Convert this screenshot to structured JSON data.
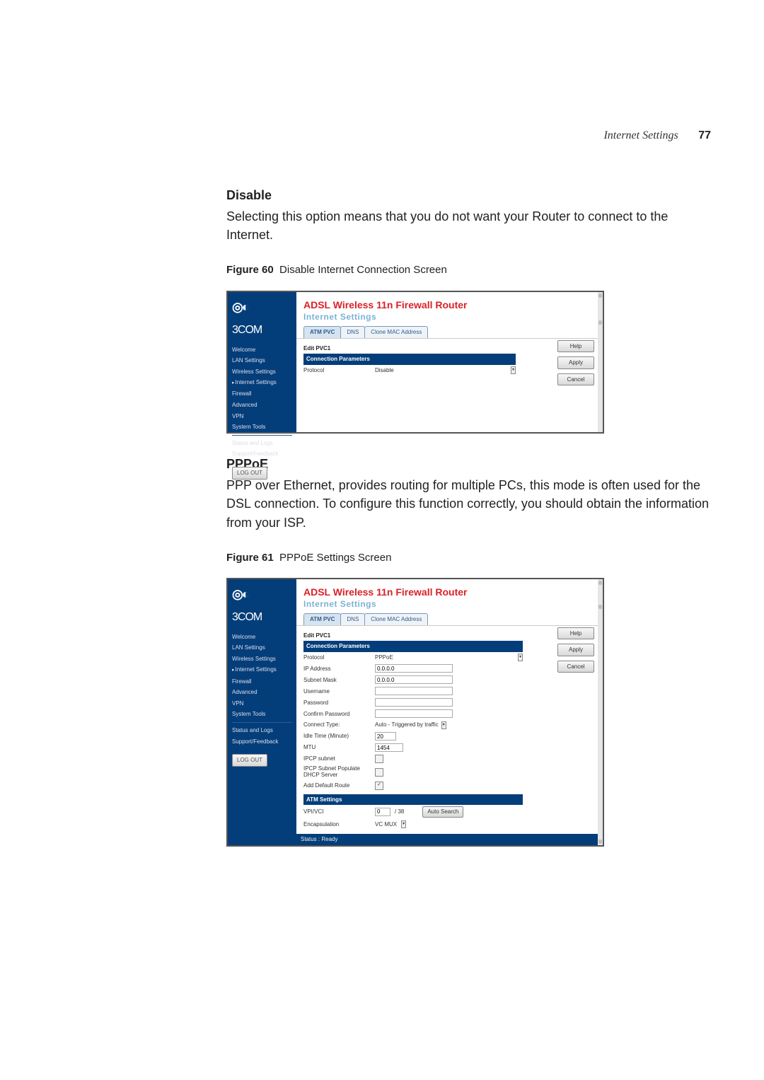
{
  "header": {
    "title": "Internet Settings",
    "page": "77"
  },
  "sections": {
    "disable": {
      "heading": "Disable",
      "text": "Selecting this option means that you do not want your Router to connect to the Internet."
    },
    "pppoe": {
      "heading": "PPPoE",
      "text": "PPP over Ethernet, provides routing for multiple PCs, this mode is often used for the DSL connection. To configure this function correctly, you should obtain the information from your ISP."
    }
  },
  "figures": {
    "f60": {
      "label": "Figure 60",
      "caption": "Disable Internet Connection Screen"
    },
    "f61": {
      "label": "Figure 61",
      "caption": "PPPoE Settings Screen"
    }
  },
  "shared": {
    "brand": "3COM",
    "product": "ADSL Wireless 11n Firewall Router",
    "page_section": "Internet Settings",
    "tabs": {
      "atm": "ATM PVC",
      "dns": "DNS",
      "clone": "Clone MAC Address"
    },
    "nav": {
      "welcome": "Welcome",
      "lan": "LAN Settings",
      "wireless": "Wireless Settings",
      "internet": "Internet Settings",
      "firewall": "Firewall",
      "advanced": "Advanced",
      "vpn": "VPN",
      "system": "System Tools",
      "status": "Status and Logs",
      "support": "Support/Feedback",
      "logout": "LOG OUT"
    },
    "buttons": {
      "help": "Help",
      "apply": "Apply",
      "cancel": "Cancel"
    },
    "edit_title": "Edit PVC1",
    "section_conn": "Connection Parameters",
    "status_bar": "Status : Ready"
  },
  "fig60": {
    "fields": {
      "protocol_label": "Protocol",
      "protocol_value": "Disable"
    }
  },
  "fig61": {
    "fields": {
      "protocol_label": "Protocol",
      "protocol_value": "PPPoE",
      "ip_label": "IP Address",
      "ip_value": "0.0.0.0",
      "subnet_label": "Subnet Mask",
      "subnet_value": "0.0.0.0",
      "user_label": "Username",
      "user_value": "",
      "pass_label": "Password",
      "pass_value": "",
      "cpass_label": "Confirm Password",
      "cpass_value": "",
      "ctype_label": "Connect Type:",
      "ctype_value": "Auto - Triggered by traffic",
      "idle_label": "Idle Time (Minute)",
      "idle_value": "20",
      "mtu_label": "MTU",
      "mtu_value": "1454",
      "ipcp_label": "IPCP subnet",
      "ipcppop_label": "IPCP Subnet Populate DHCP Server",
      "defroute_label": "Add Default Route"
    },
    "atm": {
      "section": "ATM Settings",
      "vpi_label": "VPI/VCI",
      "vpi_v1": "0",
      "vpi_v2": "/ 38",
      "autosearch": "Auto Search",
      "encap_label": "Encapsulation",
      "encap_value": "VC MUX"
    }
  }
}
